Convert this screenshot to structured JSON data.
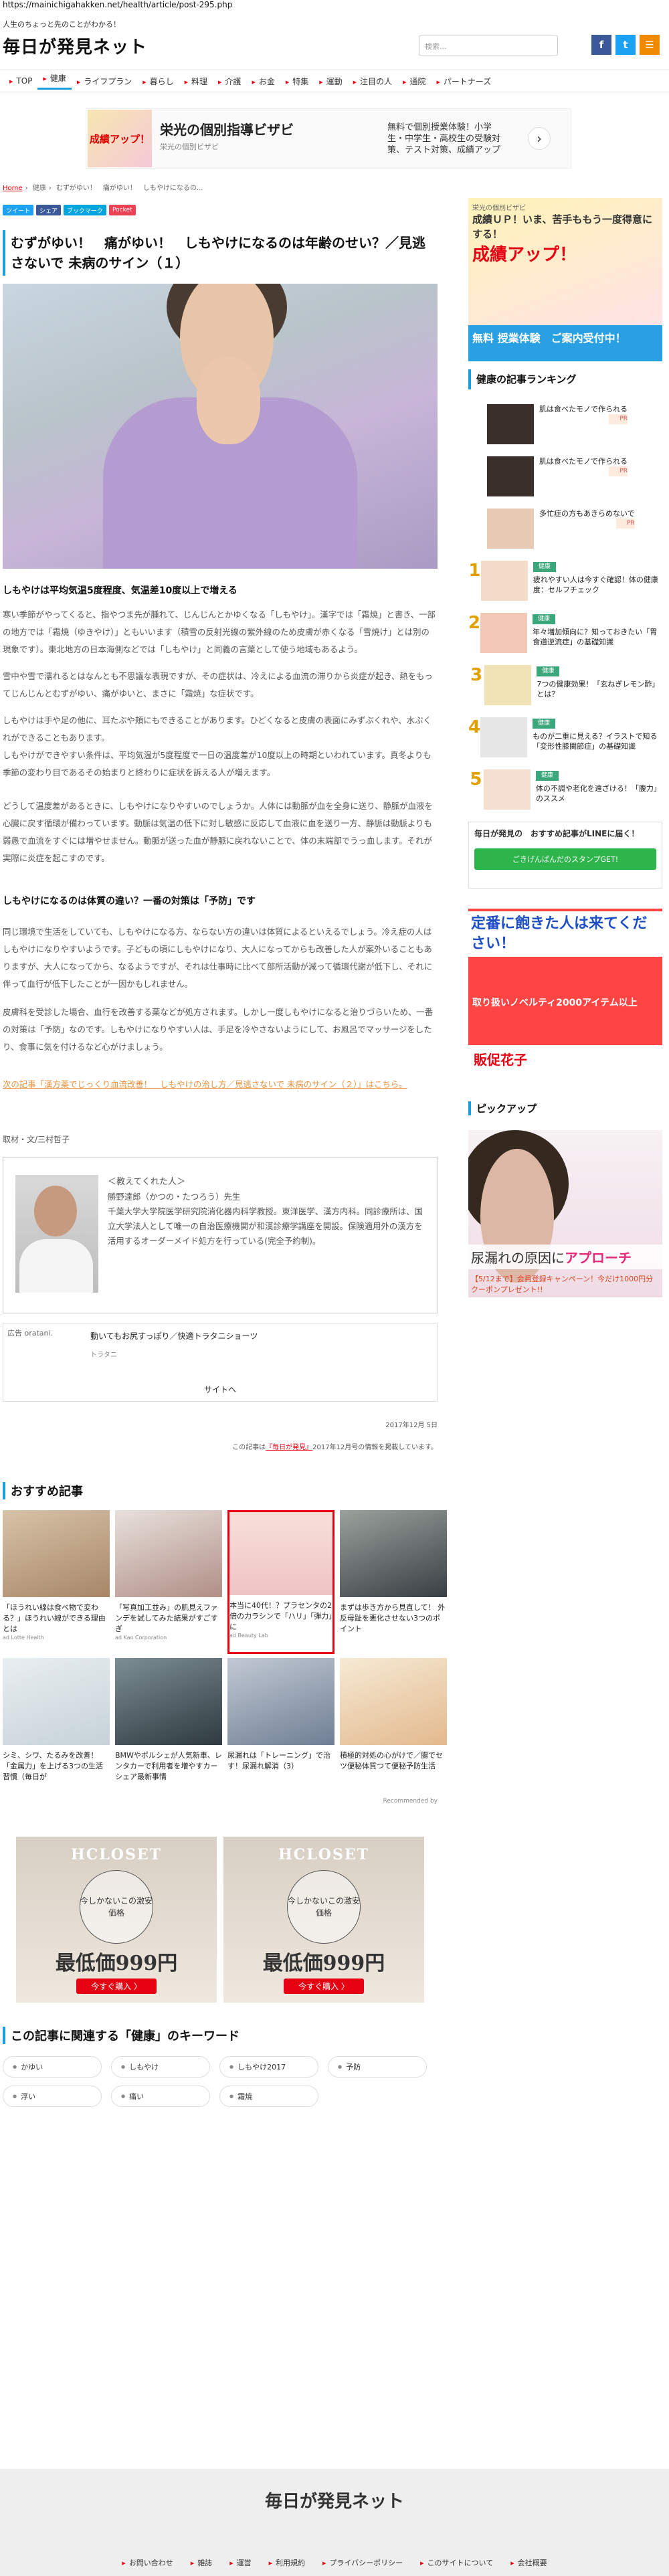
{
  "url": "https://mainichigahakken.net/health/article/post-295.php",
  "header": {
    "tagline": "人生のちょっと先のことがわかる！",
    "logo": "毎日が発見ネット",
    "search_placeholder": "検索..."
  },
  "social": {
    "facebook": "f",
    "twitter": "t",
    "rss": "☰"
  },
  "nav": [
    "TOP",
    "健康",
    "ライフプラン",
    "暮らし",
    "料理",
    "介護",
    "お金",
    "特集",
    "運動",
    "注目の人",
    "通院",
    "パートナーズ"
  ],
  "ad_top": {
    "badge": "成績アップ！",
    "title": "栄光の個別指導ビザビ",
    "brand": "栄光の個別ビザビ",
    "right": "無料で個別授業体験！小学生・中学生・高校生の受験対策、テスト対策、成績アップ",
    "next": "›"
  },
  "breadcrumb": [
    "Home",
    "健康",
    "むずがゆい！　痛がゆい！　しもやけになるの..."
  ],
  "share": [
    "ツイート",
    "シェア",
    "ブックマーク",
    "Pocket"
  ],
  "article": {
    "title": "むずがゆい！　痛がゆい！　しもやけになるのは年齢のせい？／見逃さないで 未病のサイン（１）",
    "h1": "しもやけは平均気温5度程度、気温差10度以上で増える",
    "p1": "寒い季節がやってくると、指やつま先が腫れて、じんじんとかゆくなる「しもやけ」。漢字では「霜焼」と書き、一部の地方では「霜焼（ゆきやけ）」ともいいます（積雪の反射光線の紫外線のため皮膚が赤くなる「雪焼け」とは別の現象です）。東北地方の日本海側などでは「しもやけ」と同義の言葉として使う地域もあるよう。",
    "p2": "雪中や雪で濡れるとはなんとも不思議な表現ですが、その症状は、冷えによる血流の滞りから炎症が起き、熱をもってじんじんとむずがゆい、痛がゆいと、まさに「霜焼」な症状です。",
    "p3": "しもやけは手や足の他に、耳たぶや頬にもできることがあります。ひどくなると皮膚の表面にみずぶくれや、水ぶくれができることもあります。",
    "p4": "しもやけができやすい条件は、平均気温が5度程度で一日の温度差が10度以上の時期といわれています。真冬よりも季節の変わり目であるその始まりと終わりに症状を訴える人が増えます。",
    "p5": "どうして温度差があるときに、しもやけになりやすいのでしょうか。人体には動脈が血を全身に送り、静脈が血液を心臓に戻す循環が備わっています。動脈は気温の低下に対し敏感に反応して血液に血を送り一方、静脈は動脈よりも弱愚で血流をすぐには増やせません。動脈が送った血が静脈に戻れないことで、体の末端部でうっ血します。それが実際に炎症を起こすのです。",
    "h2": "しもやけになるのは体質の違い？一番の対策は「予防」です",
    "p6": "同じ環境で生活をしていても、しもやけになる方、ならない方の違いは体質によるといえるでしょう。冷え症の人はしもやけになりやすいようです。子どもの頃にしもやけになり、大人になってからも改善した人が案外いることもありますが、大人になってから、なるようですが、それは仕事時に比べて部所活動が減って循環代謝が低下し、それに伴って血行が低下したことが一因かもしれません。",
    "p7": "皮膚科を受診した場合、血行を改善する薬などが処方されます。しかし一度しもやけになると治りづらいため、一番の対策は「予防」なのです。しもやけになりやすい人は、手足を冷やさないようにして、お風呂でマッサージをしたり、食事に気を付けるなど心がけましょう。",
    "link": "次の記事「漢方薬でじっくり血流改善！　しもやけの治し方／見逃さないで 未病のサイン（２）」はこちら。",
    "credit": "取材・文/三村哲子",
    "teacher": {
      "label": "＜教えてくれた人＞",
      "name": "勝野達郎（かつの・たつろう）先生",
      "bio": "千葉大学大学院医学研究院消化器内科学教授。東洋医学、漢方内科。同診療所は、国立大学法人として唯一の自治医療機関が和漢診療学講座を開設。保険適用外の漢方を活用するオーダーメイド処方を行っている(完全予約制)。"
    },
    "date": "2017年12月 5日",
    "source_pre": "この記事は",
    "source_link": "『毎日が発見』",
    "source_post": "2017年12月号の情報を掲載しています。"
  },
  "ad_mid": {
    "hd": "広告 oratani.",
    "name": "動いてもお尻すっぽり／快適トラタニショーツ",
    "sub": "トラタニ",
    "link": "サイトへ"
  },
  "recommend": {
    "title": "おすすめ記事",
    "items": [
      {
        "cap": "「ほうれい線は食べ物で変わる？」ほうれい線ができる理由とは",
        "sp": "ad   Lotte Health"
      },
      {
        "cap": "「写真加工並み」の肌見えファンデを試してみた結果がすごすぎ",
        "sp": "ad   Kao Corporation"
      },
      {
        "cap": "本当に40代！？プラセンタの2倍の力ラシンで「ハリ」「弾力」に",
        "sp": "ad   Beauty Lab"
      },
      {
        "cap": "まずは歩き方から見直して！ 外反母趾を悪化させない3つのポイント",
        "sp": ""
      },
      {
        "cap": "シミ、シワ、たるみを改善！「金属力」を上げる3つの生活習慣（毎日が",
        "sp": ""
      },
      {
        "cap": "BMWやポルシェが人気新車、レンタカーで利用者を増やすカーシェア最新事情",
        "sp": ""
      },
      {
        "cap": "尿漏れは「トレーニング」で治す！尿漏れ解消（3）",
        "sp": ""
      },
      {
        "cap": "積極的対処の心がけで／腸でセツ便秘体質つて便秘予防生活",
        "sp": ""
      }
    ],
    "by": "Recommended by"
  },
  "hcl": [
    {
      "brand": "HCLOSET",
      "circle": "今しかないこの激安価格",
      "price": "最低価999円",
      "cta": "今すぐ購入 〉"
    },
    {
      "brand": "HCLOSET",
      "circle": "今しかないこの激安価格",
      "price": "最低価999円",
      "cta": "今すぐ購入 〉"
    }
  ],
  "keywords": {
    "title": "この記事に関連する「健康」のキーワード",
    "items": [
      "かゆい",
      "しもやけ",
      "しもやけ2017",
      "予防",
      "浮い",
      "痛い",
      "霜焼"
    ]
  },
  "side": {
    "ad1": {
      "brand": "栄光の個別ビザビ",
      "t": "成績ＵＰ！いま、苦手ももう一度得意にする！",
      "big": "成績アップ！",
      "foot": "無料 授業体験　ご案内受付中！"
    },
    "ranking_title": "健康の記事ランキング",
    "ranking": [
      {
        "num": "",
        "lbl": "",
        "txt": "肌は食べたモノで作られる",
        "ac": "PR"
      },
      {
        "num": "",
        "lbl": "",
        "txt": "肌は食べたモノで作られる",
        "ac": "PR"
      },
      {
        "num": "",
        "lbl": "",
        "txt": "多忙症の方もあきらめないで",
        "ac": "PR"
      },
      {
        "num": "1",
        "lbl": "健康",
        "txt": "疲れやすい人は今すぐ確認！体の健康度：セルフチェック",
        "ac": ""
      },
      {
        "num": "2",
        "lbl": "健康",
        "txt": "年々増加傾向に？知っておきたい「胃食道逆流症」の基礎知識",
        "ac": ""
      },
      {
        "num": "3",
        "lbl": "健康",
        "txt": "7つの健康効果！「玄ねぎレモン酢」とは？",
        "ac": ""
      },
      {
        "num": "4",
        "lbl": "健康",
        "txt": "ものが二重に見える？イラストで知る「変形性膝関節症」の基礎知識",
        "ac": ""
      },
      {
        "num": "5",
        "lbl": "健康",
        "txt": "体の不調や老化を遠ざける！「腹力」のススメ",
        "ac": ""
      }
    ],
    "line": {
      "t": "毎日が発見の　おすすめ記事がLINEに届く！",
      "btn": "ごきげんぱんだのスタンプGET!"
    },
    "ad2": {
      "t": "定番に飽きた人は来てください！",
      "s": "取り扱いノベルティ2000アイテム以上",
      "n": "販促花子"
    },
    "pick_title": "ピックアップ",
    "pick": {
      "t1": "尿漏れの原因に",
      "t2": "アプローチ",
      "f": "【5/12まで】会員登録キャンペーン！今だけ1000円分クーポンプレゼント!!"
    }
  },
  "footer": {
    "logo": "毎日が発見ネット",
    "links": [
      "お問い合わせ",
      "雑誌",
      "運営",
      "利用規約",
      "プライバシーポリシー",
      "このサイトについて",
      "会社概要"
    ]
  }
}
